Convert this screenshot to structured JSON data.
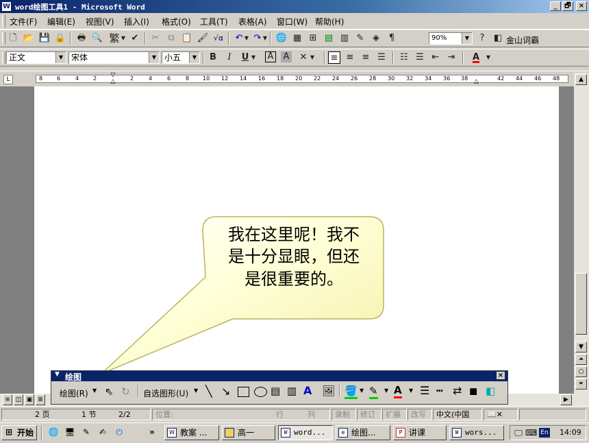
{
  "window": {
    "title": "word绘图工具1 - Microsoft Word",
    "minimize": "_",
    "restore": "🗗",
    "close": "×"
  },
  "menu": [
    "文件(F)",
    "编辑(E)",
    "视图(V)",
    "插入(I)",
    "格式(O)",
    "工具(T)",
    "表格(A)",
    "窗口(W)",
    "帮助(H)"
  ],
  "toolbar": {
    "zoom": "90%",
    "jinshan": "金山词霸",
    "traditional": "繁"
  },
  "format": {
    "style": "正文",
    "font": "宋体",
    "size": "小五"
  },
  "ruler": {
    "ticks": [
      "8",
      "6",
      "4",
      "2",
      "2",
      "4",
      "6",
      "8",
      "10",
      "12",
      "14",
      "16",
      "18",
      "20",
      "22",
      "24",
      "26",
      "28",
      "30",
      "32",
      "34",
      "36",
      "38",
      "42",
      "44",
      "46",
      "48"
    ]
  },
  "callout": {
    "lines": [
      "我在这里呢！我不",
      "是十分显眼，但还",
      "是很重要的。"
    ]
  },
  "drawing_toolbar": {
    "title": "绘图",
    "draw_menu": "绘图(R)",
    "autoshapes": "自选图形(U)"
  },
  "status": {
    "page": "2 页",
    "section": "1 节",
    "page_of": "2/2",
    "position": "位置:",
    "line": "行",
    "col": "列",
    "rec": "录制",
    "trk": "修订",
    "ext": "扩展",
    "ovr": "改写",
    "lang": "中文(中国"
  },
  "taskbar": {
    "start": "开始",
    "items": [
      "教案 ...",
      "高一",
      "word...",
      "绘图...",
      "讲课",
      "wors..."
    ],
    "clock": "14:09",
    "lang": "En"
  },
  "colors": {
    "title_active": "#0a246a",
    "callout_fill": "#ffffcc",
    "callout_stroke": "#c8c864"
  }
}
